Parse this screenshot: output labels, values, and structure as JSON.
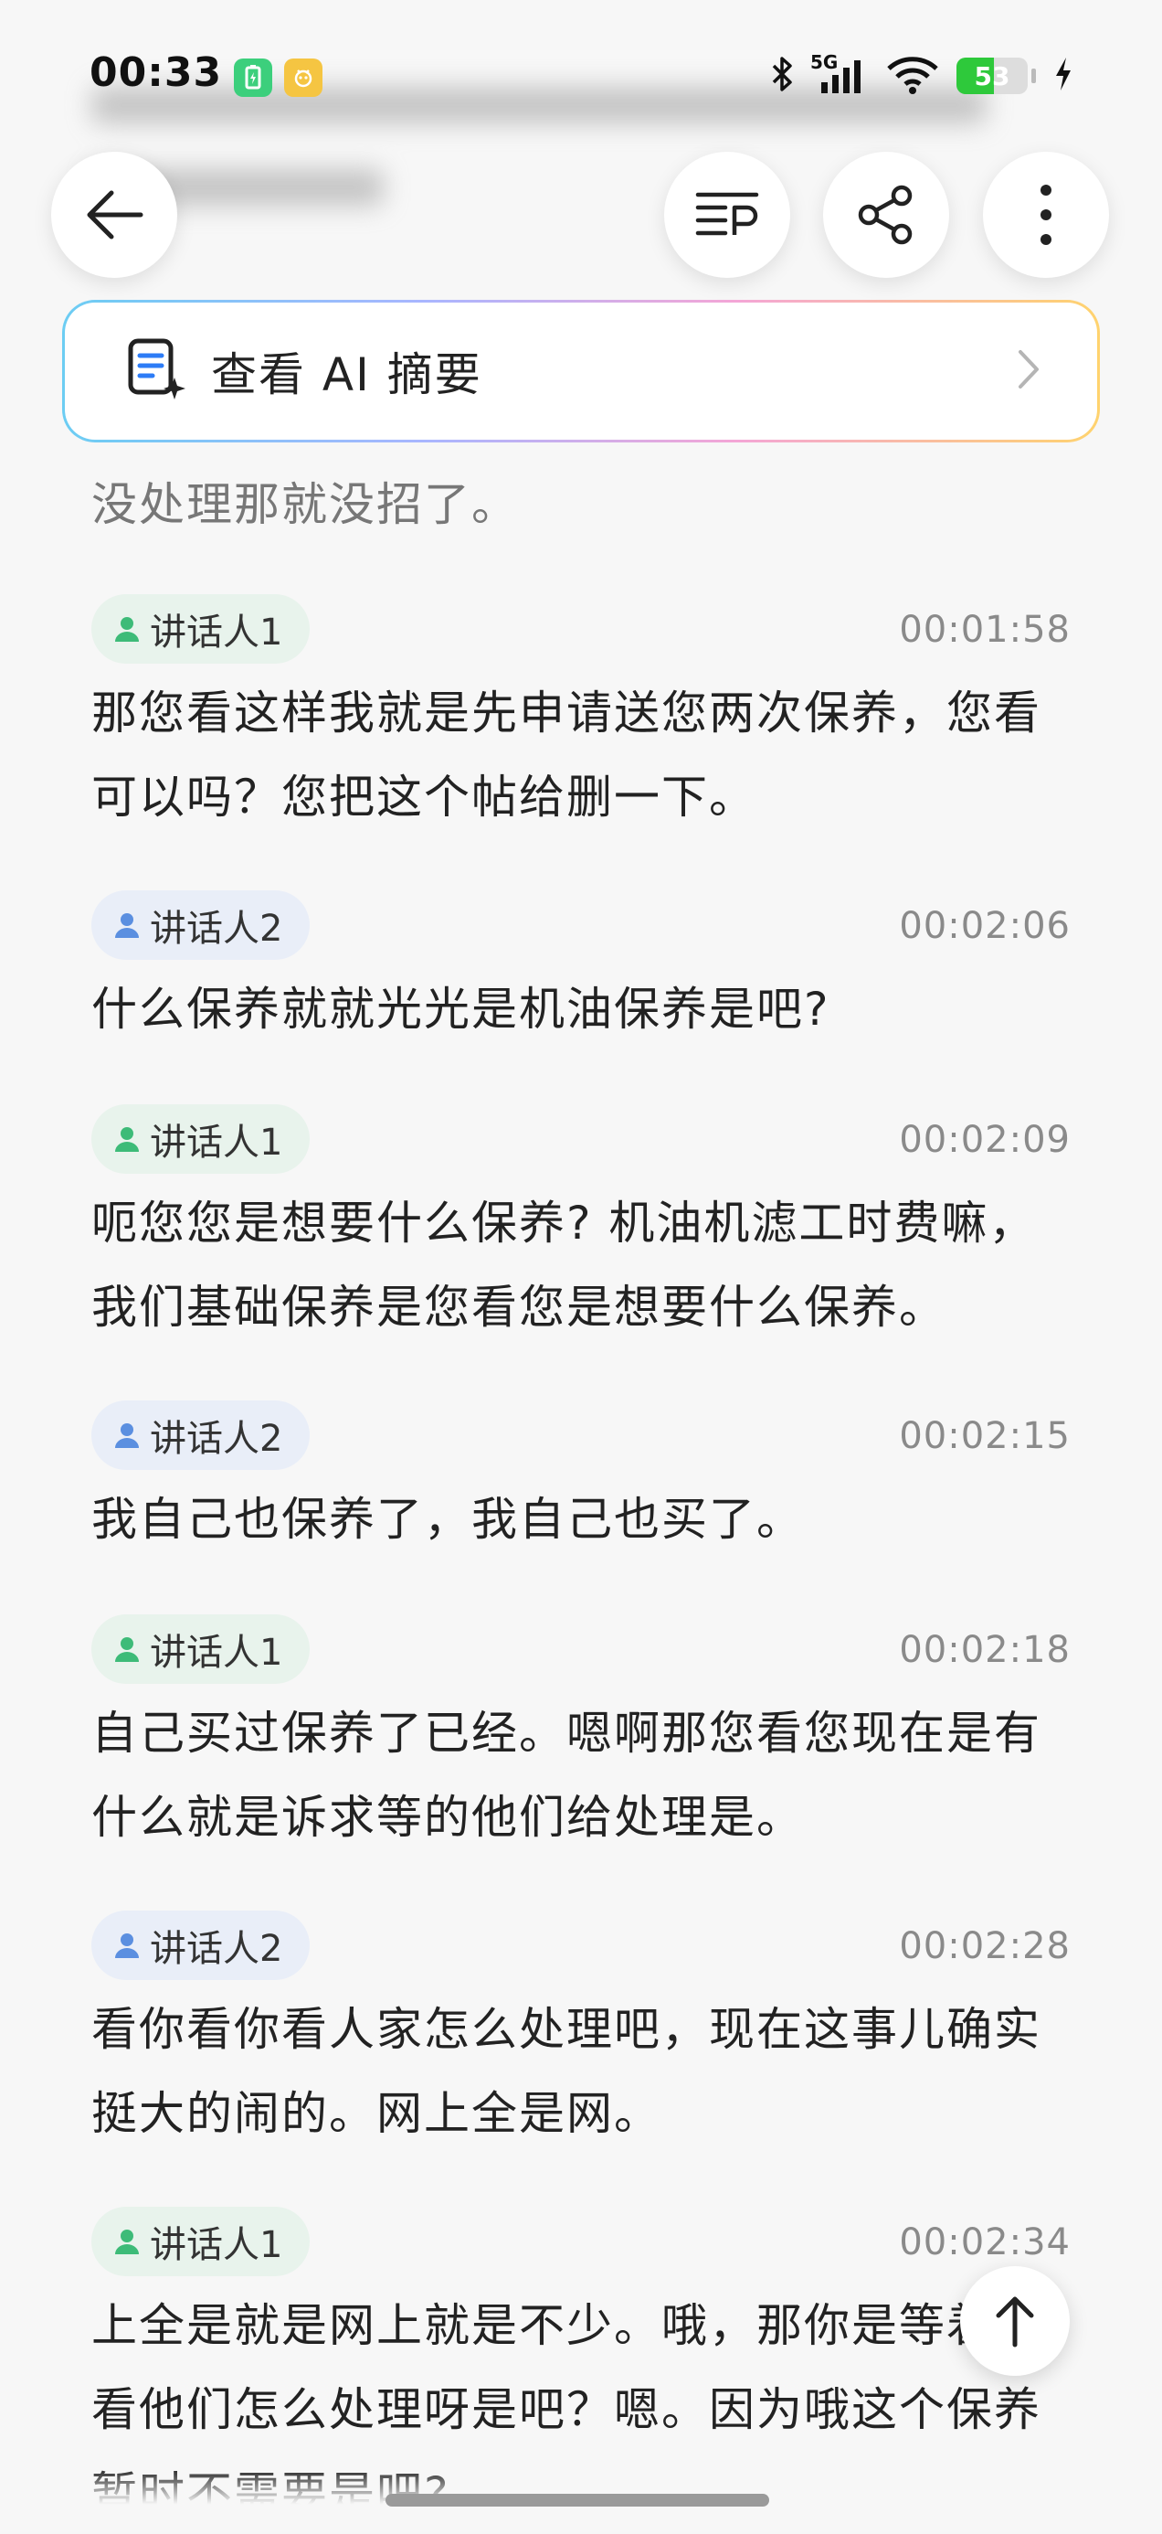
{
  "status_bar": {
    "time": "00:33",
    "signal_label": "5G",
    "battery_level": "53",
    "battery_fill_percent": 53
  },
  "toolbar": {
    "back_icon": "back-arrow-icon",
    "outline_icon": "outline-icon",
    "share_icon": "share-icon",
    "more_icon": "more-vertical-icon"
  },
  "ai_summary": {
    "label": "查看 AI 摘要"
  },
  "transcript": {
    "partial_text": "没处理那就没招了。",
    "entries": [
      {
        "speaker": "讲话人1",
        "time": "00:01:58",
        "text": "那您看这样我就是先申请送您两次保养，您看可以吗？您把这个帖给删一下。"
      },
      {
        "speaker": "讲话人2",
        "time": "00:02:06",
        "text": "什么保养就就光光是机油保养是吧?"
      },
      {
        "speaker": "讲话人1",
        "time": "00:02:09",
        "text": "呃您您是想要什么保养? 机油机滤工时费嘛，我们基础保养是您看您是想要什么保养。"
      },
      {
        "speaker": "讲话人2",
        "time": "00:02:15",
        "text": "我自己也保养了，我自己也买了。"
      },
      {
        "speaker": "讲话人1",
        "time": "00:02:18",
        "text": "自己买过保养了已经。嗯啊那您看您现在是有什么就是诉求等的他们给处理是。"
      },
      {
        "speaker": "讲话人2",
        "time": "00:02:28",
        "text": "看你看你看人家怎么处理吧，现在这事儿确实挺大的闹的。网上全是网。"
      },
      {
        "speaker": "讲话人1",
        "time": "00:02:34",
        "text": "上全是就是网上就是不少。哦，那你是等着看看他们怎么处理呀是吧？嗯。因为哦这个保养暂时不需要是吧?"
      }
    ]
  },
  "colors": {
    "speaker1_chip": "#e8f3ec",
    "speaker1_icon": "#3dbb78",
    "speaker2_chip": "#e9eef8",
    "speaker2_icon": "#5b8fe0"
  }
}
